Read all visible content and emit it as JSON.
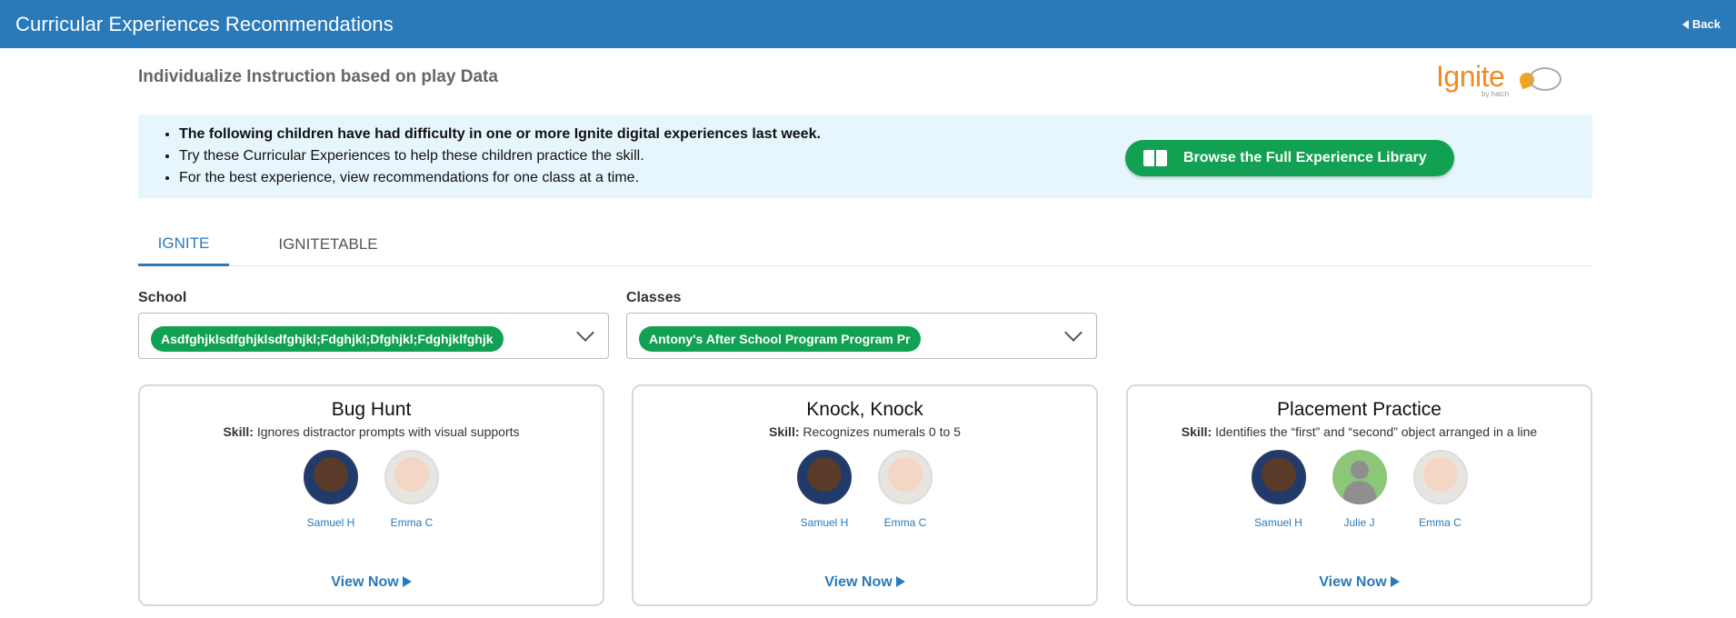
{
  "header": {
    "title": "Curricular Experiences Recommendations",
    "back_label": "Back"
  },
  "subtitle": "Individualize Instruction based on play Data",
  "logo": {
    "brand": "Ignite",
    "byline": "by hatch"
  },
  "info": {
    "bullets": [
      "The following children have had difficulty in one or more Ignite digital experiences last week.",
      "Try these Curricular Experiences to help these children practice the skill.",
      "For the best experience, view recommendations for one class at a time."
    ],
    "browse_label": "Browse the Full Experience Library"
  },
  "tabs": [
    {
      "label": "IGNITE",
      "active": true
    },
    {
      "label": "IGNITETABLE",
      "active": false
    }
  ],
  "filters": {
    "school": {
      "label": "School",
      "value": "Asdfghjklsdfghjklsdfghjkl;Fdghjkl;Dfghjkl;Fdghjklfghjk"
    },
    "classes": {
      "label": "Classes",
      "value": "Antony's After School Program Program Pr"
    }
  },
  "cards": [
    {
      "title": "Bug Hunt",
      "skill_label": "Skill:",
      "skill": "Ignores distractor prompts with visual supports",
      "children": [
        {
          "name": "Samuel H",
          "avatar": "dark"
        },
        {
          "name": "Emma C",
          "avatar": "light"
        }
      ],
      "cta": "View Now"
    },
    {
      "title": "Knock, Knock",
      "skill_label": "Skill:",
      "skill": "Recognizes numerals 0 to 5",
      "children": [
        {
          "name": "Samuel H",
          "avatar": "dark"
        },
        {
          "name": "Emma C",
          "avatar": "light"
        }
      ],
      "cta": "View Now"
    },
    {
      "title": "Placement Practice",
      "skill_label": "Skill:",
      "skill": "Identifies the “first” and “second” object arranged in a line",
      "children": [
        {
          "name": "Samuel H",
          "avatar": "dark"
        },
        {
          "name": "Julie J",
          "avatar": "blank"
        },
        {
          "name": "Emma C",
          "avatar": "light"
        }
      ],
      "cta": "View Now"
    }
  ],
  "colors": {
    "header": "#2a7ab9",
    "accent_green": "#12a052",
    "info_bg": "#e7f6fc",
    "link": "#2a7ab9"
  }
}
